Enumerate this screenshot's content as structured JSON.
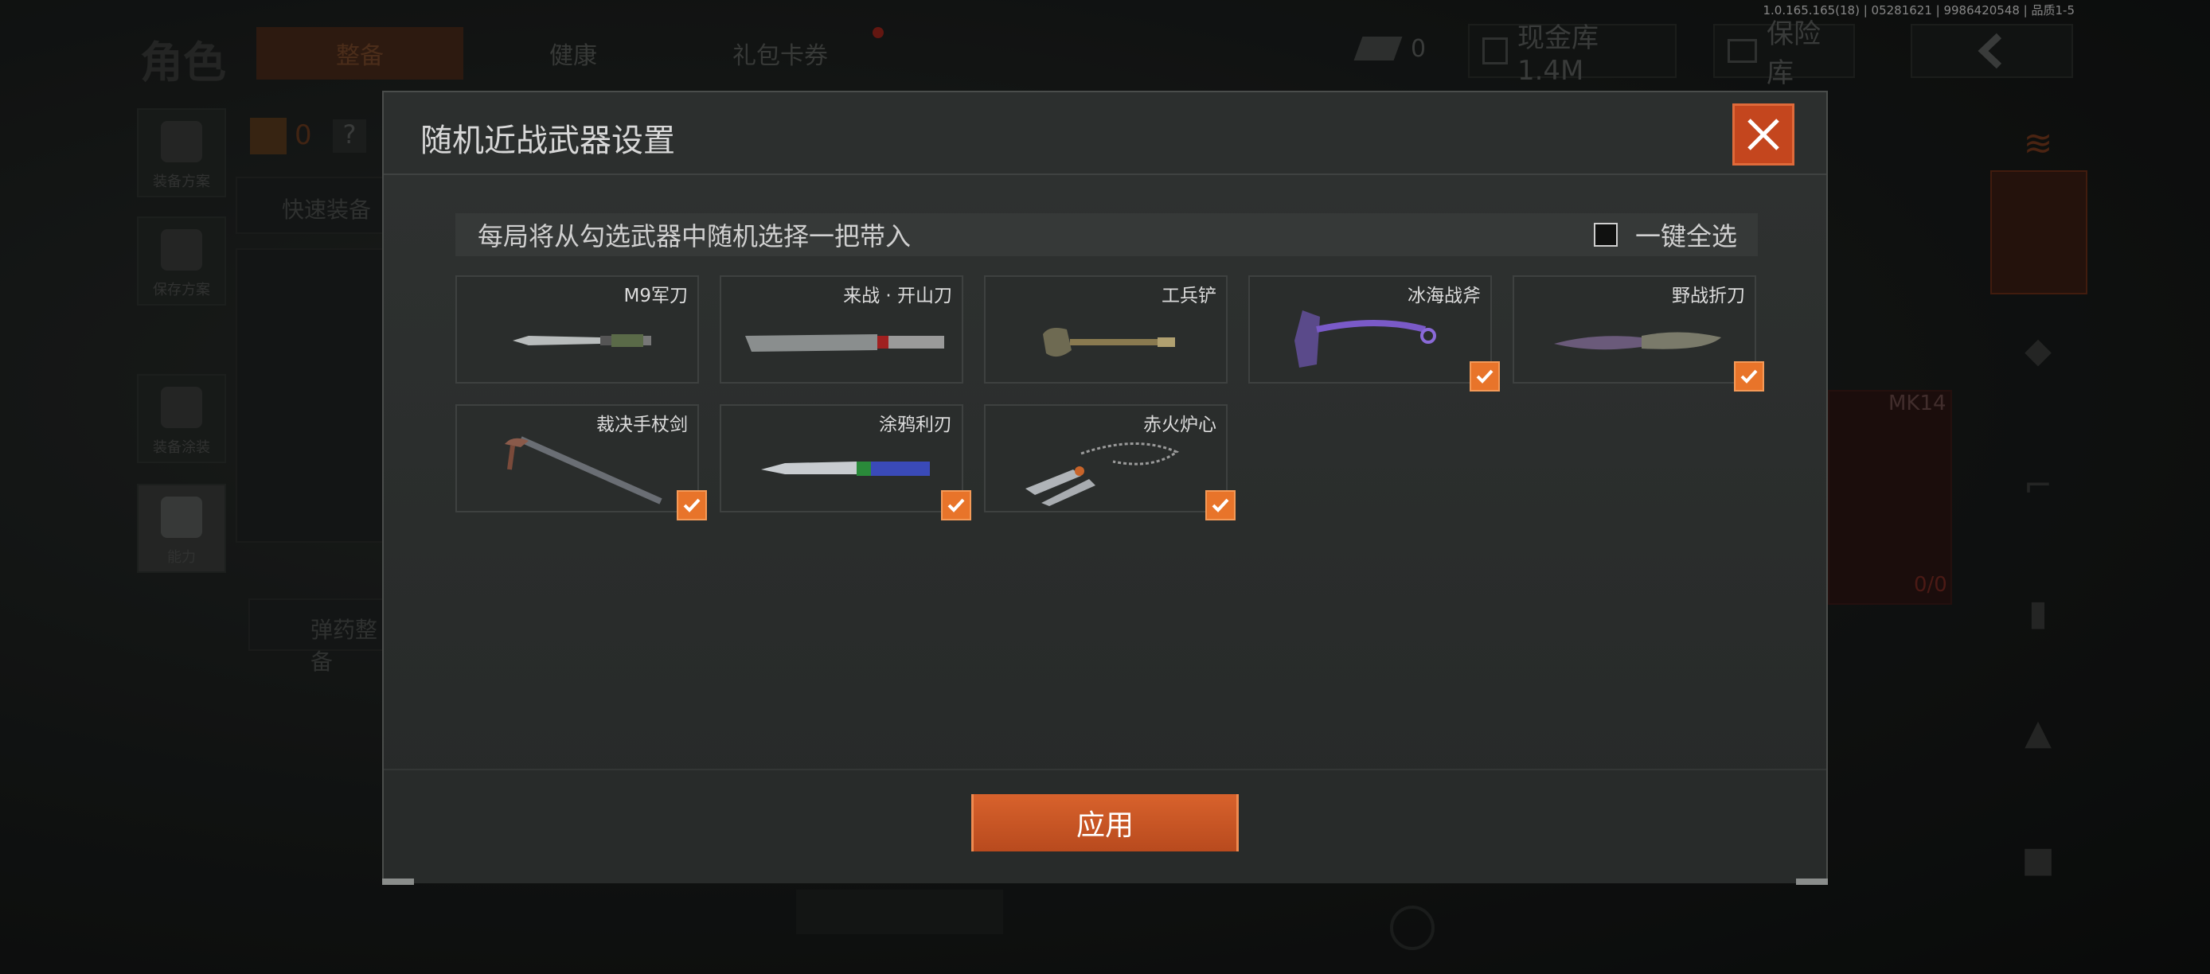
{
  "status_bar": {
    "version": "1.0.165.165(18) | 05281621 | 9986420548 | 品质1-5"
  },
  "background": {
    "page_title": "角色",
    "tabs": [
      {
        "label": "整备",
        "active": true
      },
      {
        "label": "健康",
        "active": false
      },
      {
        "label": "礼包卡券",
        "active": false
      }
    ],
    "coin_count": "0",
    "cash_vault": "现金库 1.4M",
    "safe_vault": "保险库",
    "left_menu": [
      {
        "label": "装备方案"
      },
      {
        "label": "保存方案"
      },
      {
        "label": "装备涂装"
      },
      {
        "label": "能力"
      }
    ],
    "armor_count": "0",
    "help_icon": "?",
    "quick_equip": "快速装备",
    "ammo_setup": "弹药整备",
    "weapon_slot": "MK14",
    "ammo_counter": "0/0",
    "accent_color": "#d4572a"
  },
  "modal": {
    "title": "随机近战武器设置",
    "hint": "每局将从勾选武器中随机选择一把带入",
    "select_all_label": "一键全选",
    "select_all_checked": false,
    "apply_label": "应用",
    "weapons": [
      {
        "name": "M9军刀",
        "checked": false,
        "icon": "bayonet-icon"
      },
      {
        "name": "来战 · 开山刀",
        "checked": false,
        "icon": "machete-icon"
      },
      {
        "name": "工兵铲",
        "checked": false,
        "icon": "shovel-icon"
      },
      {
        "name": "冰海战斧",
        "checked": true,
        "icon": "axe-icon"
      },
      {
        "name": "野战折刀",
        "checked": true,
        "icon": "folding-knife-icon"
      },
      {
        "name": "裁决手杖剑",
        "checked": true,
        "icon": "cane-sword-icon"
      },
      {
        "name": "涂鸦利刃",
        "checked": true,
        "icon": "graffiti-blade-icon"
      },
      {
        "name": "赤火炉心",
        "checked": true,
        "icon": "chain-kunai-icon"
      }
    ]
  }
}
